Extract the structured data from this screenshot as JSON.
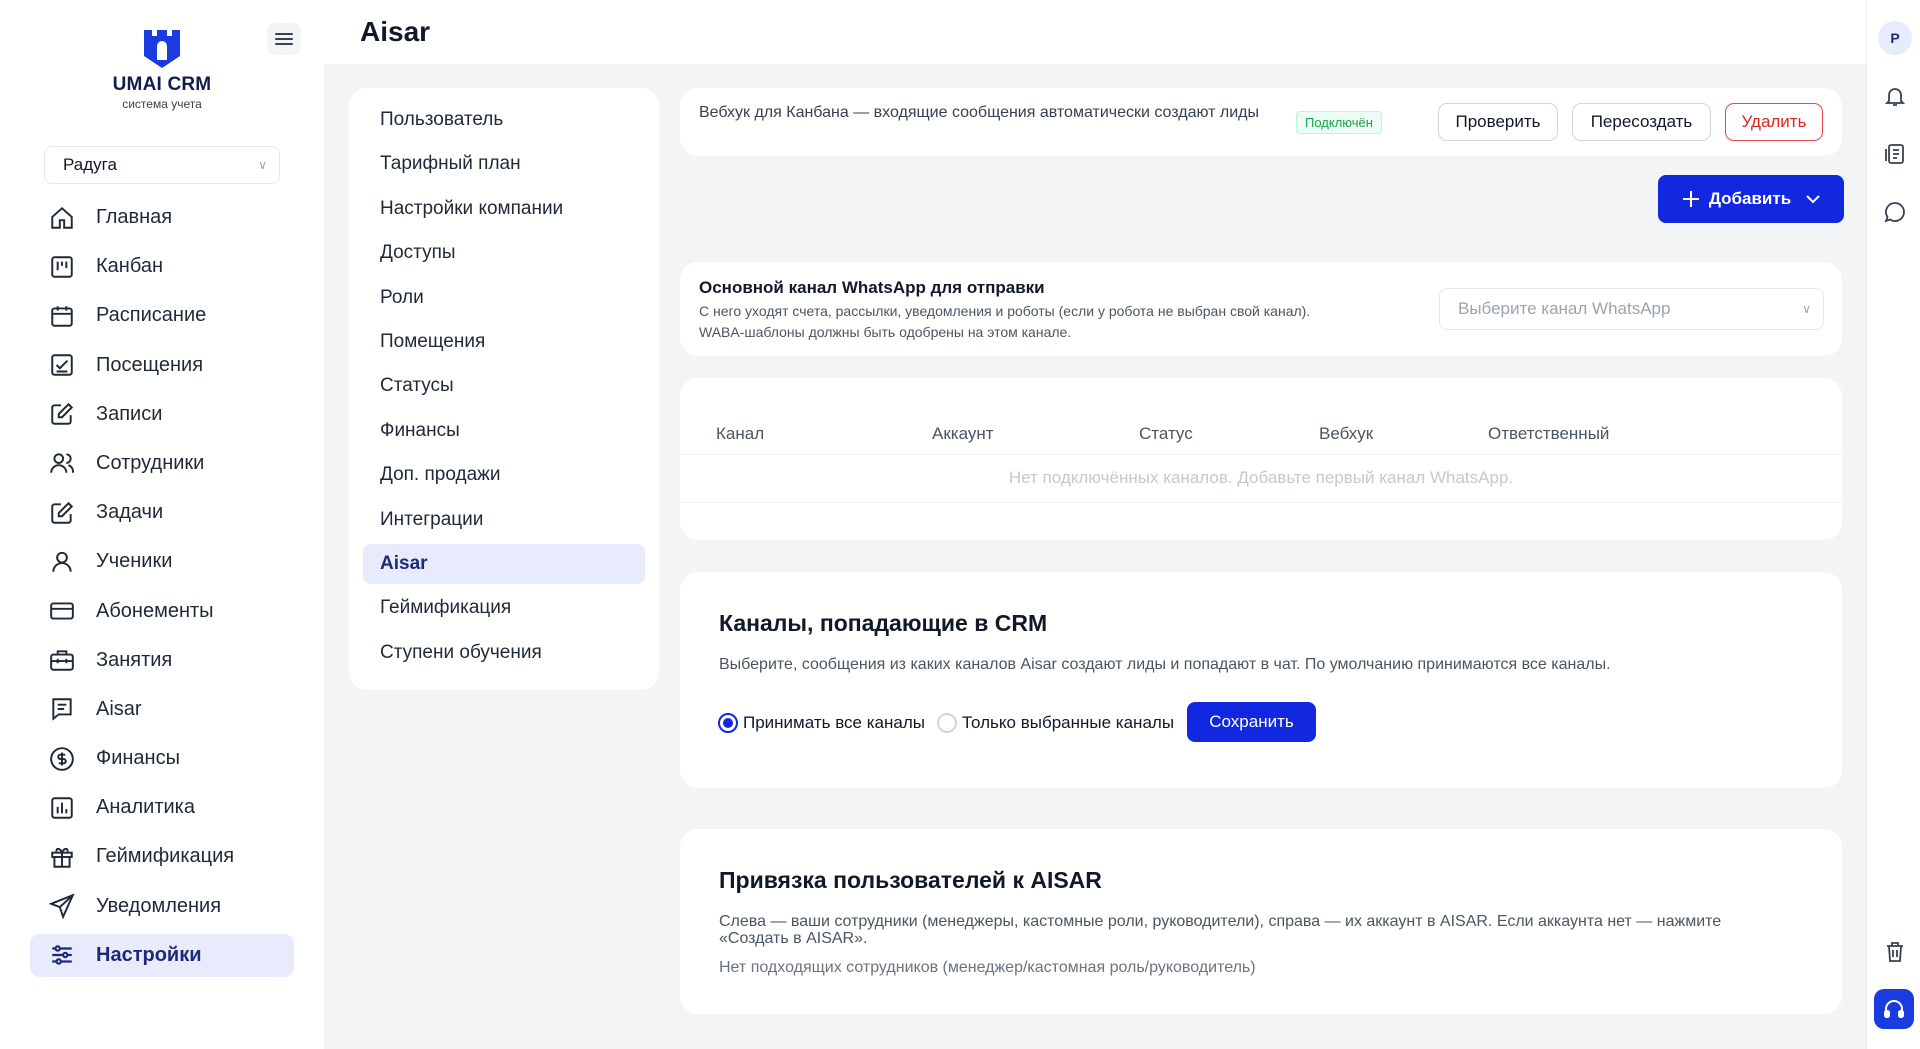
{
  "brand": {
    "name": "UMAI CRM",
    "subtitle": "система учета"
  },
  "org_select": {
    "value": "Радуга"
  },
  "nav": [
    {
      "label": "Главная",
      "icon": "home-icon"
    },
    {
      "label": "Канбан",
      "icon": "kanban-icon"
    },
    {
      "label": "Расписание",
      "icon": "calendar-icon"
    },
    {
      "label": "Посещения",
      "icon": "checklist-icon"
    },
    {
      "label": "Записи",
      "icon": "edit-icon"
    },
    {
      "label": "Сотрудники",
      "icon": "users-icon"
    },
    {
      "label": "Задачи",
      "icon": "tasks-icon"
    },
    {
      "label": "Ученики",
      "icon": "user-icon"
    },
    {
      "label": "Абонементы",
      "icon": "card-icon"
    },
    {
      "label": "Занятия",
      "icon": "briefcase-icon"
    },
    {
      "label": "Aisar",
      "icon": "message-icon"
    },
    {
      "label": "Финансы",
      "icon": "dollar-icon"
    },
    {
      "label": "Аналитика",
      "icon": "chart-icon"
    },
    {
      "label": "Геймификация",
      "icon": "gift-icon"
    },
    {
      "label": "Уведомления",
      "icon": "send-icon"
    },
    {
      "label": "Настройки",
      "icon": "sliders-icon"
    }
  ],
  "page": {
    "title": "Aisar"
  },
  "avatar": {
    "initial": "P"
  },
  "submenu": [
    "Пользователь",
    "Тарифный план",
    "Настройки компании",
    "Доступы",
    "Роли",
    "Помещения",
    "Статусы",
    "Финансы",
    "Доп. продажи",
    "Интеграции",
    "Aisar",
    "Геймификация",
    "Ступени обучения"
  ],
  "webhook": {
    "text": "Вебхук для Канбана — входящие сообщения автоматически создают лиды",
    "status": "Подключён",
    "check_label": "Проверить",
    "recreate_label": "Пересоздать",
    "delete_label": "Удалить"
  },
  "add_button": {
    "label": "Добавить"
  },
  "whatsapp": {
    "title": "Основной канал WhatsApp для отправки",
    "desc_line1": "С него уходят счета, рассылки, уведомления и роботы (если у робота не выбран свой канал).",
    "desc_line2": "WABA-шаблоны должны быть одобрены на этом канале.",
    "select_placeholder": "Выберите канал WhatsApp"
  },
  "channels_table": {
    "columns": [
      "Канал",
      "Аккаунт",
      "Статус",
      "Вебхук",
      "Ответственный"
    ],
    "empty": "Нет подключённых каналов. Добавьте первый канал WhatsApp."
  },
  "crm_channels": {
    "title": "Каналы, попадающие в CRM",
    "desc": "Выберите, сообщения из каких каналов Aisar создают лиды и попадают в чат. По умолчанию принимаются все каналы.",
    "option_all": "Принимать все каналы",
    "option_selected": "Только выбранные каналы",
    "selected_option": "all",
    "save_label": "Сохранить"
  },
  "aisar_binding": {
    "title": "Привязка пользователей к AISAR",
    "desc": "Слева — ваши сотрудники (менеджеры, кастомные роли, руководители), справа — их аккаунт в AISAR. Если аккаунта нет — нажмите «Создать в AISAR».",
    "empty": "Нет подходящих сотрудников (менеджер/кастомная роль/руководитель)"
  },
  "colors": {
    "primary": "#1228e0",
    "active_bg": "#e8ebfb",
    "danger": "#dc2626",
    "success": "#16a34a"
  }
}
